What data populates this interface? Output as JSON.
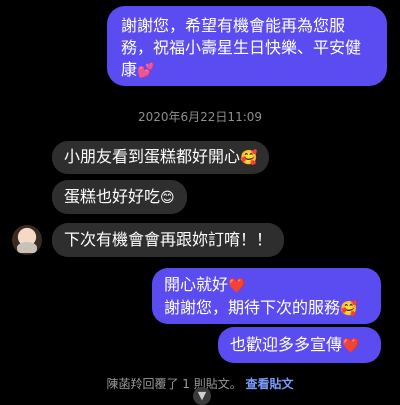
{
  "messages": {
    "sent_1": {
      "text": "謝謝您，希望有機會能再為您服務，祝福小壽星生日快樂、平安健康",
      "emoji": "💕"
    },
    "timestamp": "2020年6月22日11:09",
    "received": [
      {
        "text": "小朋友看到蛋糕都好開心",
        "emoji": "🥰"
      },
      {
        "text": "蛋糕也好好吃",
        "emoji": "😊"
      },
      {
        "text": "下次有機會會再跟妳訂唷！！",
        "emoji": ""
      }
    ],
    "sent_2": {
      "line1": "開心就好",
      "line1_emoji": "❤️",
      "line2": "謝謝您，期待下次的服務",
      "line2_emoji": "🥰"
    },
    "sent_3": {
      "text": "也歡迎多多宣傳",
      "emoji": "❤️"
    }
  },
  "footer": {
    "text": "陳菡羚回覆了 1 則貼文。",
    "link": "查看貼文"
  },
  "icons": {
    "avatar": "user-avatar",
    "scroll": "arrow-down-icon"
  },
  "colors": {
    "sent_bubble": "#5b4cf2",
    "received_bubble": "#2e2e2e",
    "link": "#7a9cff"
  }
}
